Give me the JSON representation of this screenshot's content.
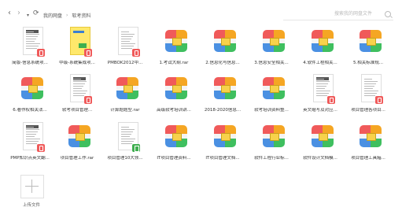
{
  "nav": {
    "back_icon": "chevron-left-icon",
    "forward_icon": "chevron-right-icon",
    "dropdown_icon": "chevron-down-icon",
    "refresh_icon": "refresh-icon"
  },
  "breadcrumb": {
    "root": "我的网盘",
    "sep": "›",
    "current": "软考资料"
  },
  "search": {
    "placeholder": "搜索我的网盘文件"
  },
  "files": [
    {
      "name": "简版-信息系统项...",
      "kind": "pdf-doc"
    },
    {
      "name": "中级-系统集成项...",
      "kind": "pdf-book"
    },
    {
      "name": "PMBOK2012中...",
      "kind": "pdf-doc2"
    },
    {
      "name": "1.考试大纲.rar",
      "kind": "archive"
    },
    {
      "name": "2.信息化与信息...",
      "kind": "archive"
    },
    {
      "name": "3.信息安全相关...",
      "kind": "archive"
    },
    {
      "name": "4.软件工程相关...",
      "kind": "archive"
    },
    {
      "name": "5.相关标准规...",
      "kind": "archive"
    },
    {
      "name": "6.著作权相关法...",
      "kind": "archive"
    },
    {
      "name": "软考项目管理...",
      "kind": "pdf-doc"
    },
    {
      "name": "计算题题型.rar",
      "kind": "archive"
    },
    {
      "name": "高级软考培训讲...",
      "kind": "archive"
    },
    {
      "name": "2018-2020信息...",
      "kind": "archive"
    },
    {
      "name": "软考培训资料整...",
      "kind": "archive"
    },
    {
      "name": "英文缩写及对应...",
      "kind": "pdf-doc"
    },
    {
      "name": "项目管理各项目...",
      "kind": "pdf-doc2"
    },
    {
      "name": "PMP知识点英文翻...",
      "kind": "pdf-doc"
    },
    {
      "name": "项目管理工作.rar",
      "kind": "archive"
    },
    {
      "name": "项目管理10大领...",
      "kind": "xls-doc"
    },
    {
      "name": "IT项目管理资料...",
      "kind": "archive"
    },
    {
      "name": "IT项目管理文档...",
      "kind": "archive"
    },
    {
      "name": "软件工程行业标...",
      "kind": "archive"
    },
    {
      "name": "软件设计文档模...",
      "kind": "archive"
    },
    {
      "name": "项目管理工具箱...",
      "kind": "archive"
    }
  ],
  "upload": {
    "label": "上传文件",
    "icon": "plus-icon"
  },
  "colors": {
    "archive_top_left": "#f05a5a",
    "archive_top_right": "#f5a623",
    "archive_bottom_left": "#4a90e2",
    "archive_bottom_right": "#3fbf5f",
    "pdf_badge": "#f05a5a",
    "xls_badge": "#3fae4f"
  }
}
